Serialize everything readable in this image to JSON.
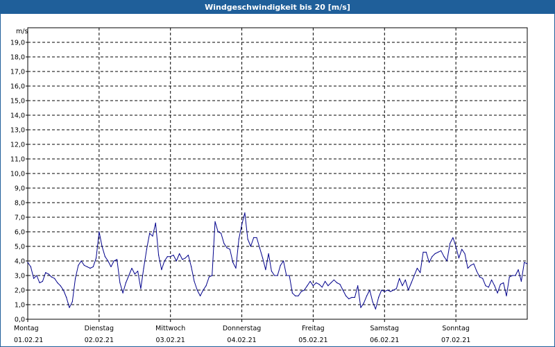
{
  "window": {
    "title": "Windgeschwindigkeit bis 20 [m/s]"
  },
  "colors": {
    "titlebar": "#1f5f9a",
    "line": "#00008b",
    "grid": "#000000"
  },
  "chart_data": {
    "type": "line",
    "title": "Windgeschwindigkeit bis 20 [m/s]",
    "ylabel": "m/s",
    "ylim": [
      0,
      20
    ],
    "yticks": [
      "0,0",
      "1,0",
      "2,0",
      "3,0",
      "4,0",
      "5,0",
      "6,0",
      "7,0",
      "8,0",
      "9,0",
      "10,0",
      "11,0",
      "12,0",
      "13,0",
      "14,0",
      "15,0",
      "16,0",
      "17,0",
      "18,0",
      "19,0"
    ],
    "xlim": [
      "01.02.21 00:00",
      "08.02.21 00:00"
    ],
    "grid": true,
    "xticks": [
      {
        "day": "Montag",
        "date": "01.02.21"
      },
      {
        "day": "Dienstag",
        "date": "02.02.21"
      },
      {
        "day": "Mittwoch",
        "date": "03.02.21"
      },
      {
        "day": "Donnerstag",
        "date": "04.02.21"
      },
      {
        "day": "Freitag",
        "date": "05.02.21"
      },
      {
        "day": "Samstag",
        "date": "06.02.21"
      },
      {
        "day": "Sonntag",
        "date": "07.02.21"
      }
    ],
    "series": [
      {
        "points": [
          [
            "01.02.21 00:00",
            3.9
          ],
          [
            "01.02.21 01:00",
            3.6
          ],
          [
            "01.02.21 02:00",
            2.8
          ],
          [
            "01.02.21 03:00",
            3.0
          ],
          [
            "01.02.21 04:00",
            2.5
          ],
          [
            "01.02.21 05:00",
            2.6
          ],
          [
            "01.02.21 06:00",
            3.2
          ],
          [
            "01.02.21 07:00",
            3.1
          ],
          [
            "01.02.21 08:00",
            2.9
          ],
          [
            "01.02.21 09:00",
            2.8
          ],
          [
            "01.02.21 10:00",
            2.5
          ],
          [
            "01.02.21 11:00",
            2.3
          ],
          [
            "01.02.21 12:00",
            2.0
          ],
          [
            "01.02.21 13:00",
            1.5
          ],
          [
            "01.02.21 14:00",
            0.8
          ],
          [
            "01.02.21 15:00",
            1.2
          ],
          [
            "01.02.21 16:00",
            2.8
          ],
          [
            "01.02.21 17:00",
            3.7
          ],
          [
            "01.02.21 18:00",
            4.0
          ],
          [
            "01.02.21 19:00",
            3.7
          ],
          [
            "01.02.21 20:00",
            3.6
          ],
          [
            "01.02.21 21:00",
            3.5
          ],
          [
            "01.02.21 22:00",
            3.6
          ],
          [
            "01.02.21 23:00",
            4.2
          ],
          [
            "02.02.21 00:00",
            6.0
          ],
          [
            "02.02.21 01:00",
            5.0
          ],
          [
            "02.02.21 02:00",
            4.3
          ],
          [
            "02.02.21 03:00",
            4.0
          ],
          [
            "02.02.21 04:00",
            3.6
          ],
          [
            "02.02.21 05:00",
            4.0
          ],
          [
            "02.02.21 06:00",
            4.1
          ],
          [
            "02.02.21 07:00",
            2.5
          ],
          [
            "02.02.21 08:00",
            1.8
          ],
          [
            "02.02.21 09:00",
            2.5
          ],
          [
            "02.02.21 10:00",
            3.0
          ],
          [
            "02.02.21 11:00",
            3.5
          ],
          [
            "02.02.21 12:00",
            3.1
          ],
          [
            "02.02.21 13:00",
            3.3
          ],
          [
            "02.02.21 14:00",
            2.1
          ],
          [
            "02.02.21 15:00",
            3.5
          ],
          [
            "02.02.21 16:00",
            4.8
          ],
          [
            "02.02.21 17:00",
            5.9
          ],
          [
            "02.02.21 18:00",
            5.7
          ],
          [
            "02.02.21 19:00",
            6.6
          ],
          [
            "02.02.21 20:00",
            4.4
          ],
          [
            "02.02.21 21:00",
            3.4
          ],
          [
            "02.02.21 22:00",
            4.0
          ],
          [
            "02.02.21 23:00",
            4.3
          ],
          [
            "03.02.21 00:00",
            4.3
          ],
          [
            "03.02.21 01:00",
            4.4
          ],
          [
            "03.02.21 02:00",
            4.0
          ],
          [
            "03.02.21 03:00",
            4.5
          ],
          [
            "03.02.21 04:00",
            4.1
          ],
          [
            "03.02.21 05:00",
            4.2
          ],
          [
            "03.02.21 06:00",
            4.4
          ],
          [
            "03.02.21 07:00",
            3.6
          ],
          [
            "03.02.21 08:00",
            2.6
          ],
          [
            "03.02.21 09:00",
            2.0
          ],
          [
            "03.02.21 10:00",
            1.6
          ],
          [
            "03.02.21 11:00",
            2.0
          ],
          [
            "03.02.21 12:00",
            2.3
          ],
          [
            "03.02.21 13:00",
            2.9
          ],
          [
            "03.02.21 14:00",
            3.0
          ],
          [
            "03.02.21 15:00",
            6.7
          ],
          [
            "03.02.21 16:00",
            6.0
          ],
          [
            "03.02.21 17:00",
            5.9
          ],
          [
            "03.02.21 18:00",
            5.2
          ],
          [
            "03.02.21 19:00",
            4.9
          ],
          [
            "03.02.21 20:00",
            4.8
          ],
          [
            "03.02.21 21:00",
            3.9
          ],
          [
            "03.02.21 22:00",
            3.5
          ],
          [
            "03.02.21 23:00",
            5.5
          ],
          [
            "04.02.21 00:00",
            6.5
          ],
          [
            "04.02.21 01:00",
            7.3
          ],
          [
            "04.02.21 02:00",
            5.5
          ],
          [
            "04.02.21 03:00",
            5.0
          ],
          [
            "04.02.21 04:00",
            5.6
          ],
          [
            "04.02.21 05:00",
            5.6
          ],
          [
            "04.02.21 06:00",
            4.9
          ],
          [
            "04.02.21 07:00",
            4.2
          ],
          [
            "04.02.21 08:00",
            3.4
          ],
          [
            "04.02.21 09:00",
            4.5
          ],
          [
            "04.02.21 10:00",
            3.3
          ],
          [
            "04.02.21 11:00",
            3.0
          ],
          [
            "04.02.21 12:00",
            3.0
          ],
          [
            "04.02.21 13:00",
            3.7
          ],
          [
            "04.02.21 14:00",
            4.0
          ],
          [
            "04.02.21 15:00",
            3.0
          ],
          [
            "04.02.21 16:00",
            3.0
          ],
          [
            "04.02.21 17:00",
            1.8
          ],
          [
            "04.02.21 18:00",
            1.6
          ],
          [
            "04.02.21 19:00",
            1.6
          ],
          [
            "04.02.21 20:00",
            1.9
          ],
          [
            "04.02.21 21:00",
            2.0
          ],
          [
            "04.02.21 22:00",
            2.3
          ],
          [
            "04.02.21 23:00",
            2.6
          ],
          [
            "05.02.21 00:00",
            2.3
          ],
          [
            "05.02.21 01:00",
            2.5
          ],
          [
            "05.02.21 02:00",
            2.4
          ],
          [
            "05.02.21 03:00",
            2.2
          ],
          [
            "05.02.21 04:00",
            2.6
          ],
          [
            "05.02.21 05:00",
            2.3
          ],
          [
            "05.02.21 06:00",
            2.5
          ],
          [
            "05.02.21 07:00",
            2.7
          ],
          [
            "05.02.21 08:00",
            2.5
          ],
          [
            "05.02.21 09:00",
            2.4
          ],
          [
            "05.02.21 10:00",
            2.0
          ],
          [
            "05.02.21 11:00",
            1.6
          ],
          [
            "05.02.21 12:00",
            1.4
          ],
          [
            "05.02.21 13:00",
            1.5
          ],
          [
            "05.02.21 14:00",
            1.5
          ],
          [
            "05.02.21 15:00",
            2.3
          ],
          [
            "05.02.21 16:00",
            0.8
          ],
          [
            "05.02.21 17:00",
            1.1
          ],
          [
            "05.02.21 18:00",
            1.6
          ],
          [
            "05.02.21 19:00",
            2.0
          ],
          [
            "05.02.21 20:00",
            1.2
          ],
          [
            "05.02.21 21:00",
            0.7
          ],
          [
            "05.02.21 22:00",
            1.5
          ],
          [
            "05.02.21 23:00",
            2.0
          ],
          [
            "06.02.21 00:00",
            1.9
          ],
          [
            "06.02.21 01:00",
            2.0
          ],
          [
            "06.02.21 02:00",
            1.9
          ],
          [
            "06.02.21 03:00",
            2.0
          ],
          [
            "06.02.21 04:00",
            2.1
          ],
          [
            "06.02.21 05:00",
            2.8
          ],
          [
            "06.02.21 06:00",
            2.3
          ],
          [
            "06.02.21 07:00",
            2.7
          ],
          [
            "06.02.21 08:00",
            2.0
          ],
          [
            "06.02.21 09:00",
            2.5
          ],
          [
            "06.02.21 10:00",
            3.0
          ],
          [
            "06.02.21 11:00",
            3.5
          ],
          [
            "06.02.21 12:00",
            3.2
          ],
          [
            "06.02.21 13:00",
            4.6
          ],
          [
            "06.02.21 14:00",
            4.6
          ],
          [
            "06.02.21 15:00",
            3.9
          ],
          [
            "06.02.21 16:00",
            4.3
          ],
          [
            "06.02.21 17:00",
            4.5
          ],
          [
            "06.02.21 18:00",
            4.6
          ],
          [
            "06.02.21 19:00",
            4.7
          ],
          [
            "06.02.21 20:00",
            4.3
          ],
          [
            "06.02.21 21:00",
            4.0
          ],
          [
            "06.02.21 22:00",
            5.2
          ],
          [
            "06.02.21 23:00",
            5.6
          ],
          [
            "07.02.21 00:00",
            5.0
          ],
          [
            "07.02.21 01:00",
            4.2
          ],
          [
            "07.02.21 02:00",
            4.8
          ],
          [
            "07.02.21 03:00",
            4.5
          ],
          [
            "07.02.21 04:00",
            3.5
          ],
          [
            "07.02.21 05:00",
            3.7
          ],
          [
            "07.02.21 06:00",
            3.8
          ],
          [
            "07.02.21 07:00",
            3.3
          ],
          [
            "07.02.21 08:00",
            2.9
          ],
          [
            "07.02.21 09:00",
            2.8
          ],
          [
            "07.02.21 10:00",
            2.3
          ],
          [
            "07.02.21 11:00",
            2.2
          ],
          [
            "07.02.21 12:00",
            2.7
          ],
          [
            "07.02.21 13:00",
            2.3
          ],
          [
            "07.02.21 14:00",
            1.8
          ],
          [
            "07.02.21 15:00",
            2.4
          ],
          [
            "07.02.21 16:00",
            2.5
          ],
          [
            "07.02.21 17:00",
            1.6
          ],
          [
            "07.02.21 18:00",
            2.9
          ],
          [
            "07.02.21 19:00",
            3.0
          ],
          [
            "07.02.21 20:00",
            3.0
          ],
          [
            "07.02.21 21:00",
            3.4
          ],
          [
            "07.02.21 22:00",
            2.6
          ],
          [
            "07.02.21 23:00",
            3.9
          ],
          [
            "08.02.21 00:00",
            3.8
          ]
        ]
      }
    ]
  }
}
